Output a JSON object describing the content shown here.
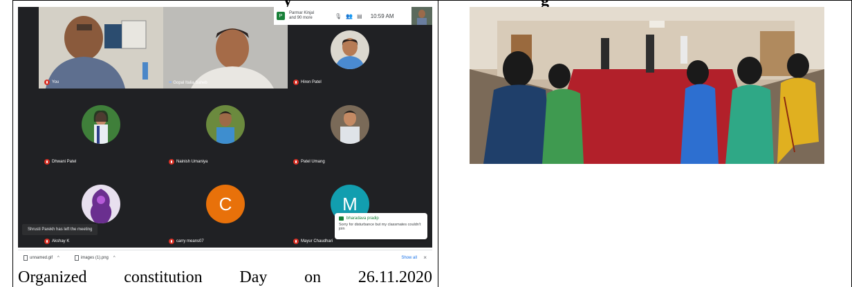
{
  "document": {
    "heading_fragment": "y",
    "heading_fragment_right": "g",
    "caption": "Organized constitution Day on 26.11.2020"
  },
  "meeting": {
    "top_bar": {
      "badge_letter": "P",
      "participant_line1": "Parmar Kinjal",
      "participant_line2": "and 90 more",
      "time": "10:59 AM",
      "self_label": "You"
    },
    "tiles": [
      {
        "name": "You"
      },
      {
        "name": "Gopal Italia Saheb"
      },
      {
        "name": "Hiren Patel"
      },
      {
        "name": "Dhwani Patel"
      },
      {
        "name": "Nainish Umaniya"
      },
      {
        "name": "Patel Umang"
      },
      {
        "name": "Akshay K"
      },
      {
        "name": "carry means07",
        "letter": "C"
      },
      {
        "name": "Mayur Chaudhari",
        "letter": "M"
      }
    ],
    "toast": "Shrusti Parekh has left the meeting",
    "chat": {
      "sender": "bharadava pradip",
      "message": "Sorry for disturbance but my classmates couldn't join"
    }
  },
  "downloads": {
    "items": [
      {
        "file": "unnamed.gif"
      },
      {
        "file": "images (1).png"
      }
    ],
    "show_all": "Show all",
    "close": "×"
  },
  "colors": {
    "meet_bg": "#202124",
    "tile_orange": "#e8710a",
    "tile_teal": "#129eaf",
    "accent_green": "#188038"
  },
  "icons": [
    "mic-off-icon",
    "people-icon",
    "chat-icon",
    "file-icon",
    "close-icon"
  ]
}
